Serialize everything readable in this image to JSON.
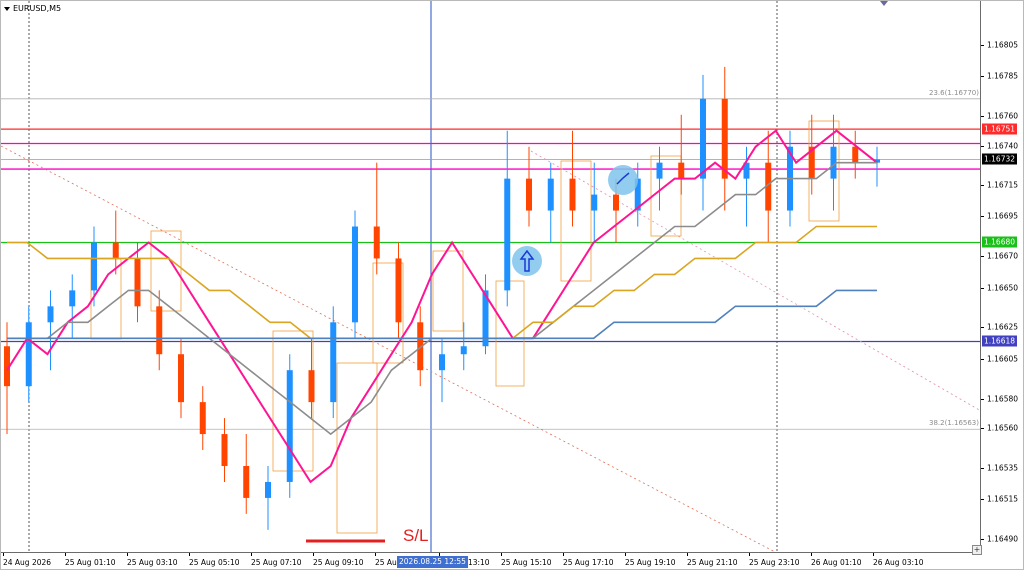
{
  "header": {
    "symbol": "EURUSD,M5"
  },
  "colors": {
    "bull": "#1e90ff",
    "bear": "#ff4500",
    "ma_fast": "#ff1493",
    "ma_mid": "#8c8c8c",
    "ma_slow": "#daa520",
    "ma_long": "#4f81bd",
    "res_red": "#ff2a2a",
    "res_magenta": "#ff00c8",
    "sup_green": "#18c018",
    "sup_blue": "#4040c0",
    "stop_loss": "#e32020",
    "signal_circle": "#7fc4ec",
    "signal_arrow": "#1a3ad8"
  },
  "price_axis": {
    "labels": [
      "1.16805",
      "1.16785",
      "1.16760",
      "1.16740",
      "1.16715",
      "1.16695",
      "1.16670",
      "1.16650",
      "1.16625",
      "1.16605",
      "1.16580",
      "1.16560",
      "1.16535",
      "1.16515",
      "1.16490"
    ],
    "range": [
      1.16488,
      1.16825
    ],
    "tags": [
      {
        "text": "1.16751",
        "price": 1.16751,
        "color": "#ff2a2a"
      },
      {
        "text": "1.16732",
        "price": 1.16732,
        "color": "#000000"
      },
      {
        "text": "1.16680",
        "price": 1.1668,
        "color": "#18c018"
      },
      {
        "text": "1.16618",
        "price": 1.16618,
        "color": "#4040c0"
      }
    ]
  },
  "time_axis": {
    "labels": [
      "24 Aug 2026",
      "25 Aug 01:10",
      "25 Aug 03:10",
      "25 Aug 05:10",
      "25 Aug 07:10",
      "25 Aug 09:10",
      "25 Aug",
      "25 Aug 13:10",
      "25 Aug 15:10",
      "25 Aug 17:10",
      "25 Aug 19:10",
      "25 Aug 21:10",
      "25 Aug 23:10",
      "26 Aug 01:10",
      "26 Aug 03:10"
    ],
    "cursor_date": "2026.08.25 12:55"
  },
  "fibonacci": [
    {
      "text": "23.6(1.16770)",
      "price": 1.1677
    },
    {
      "text": "38.2(1.16563)",
      "price": 1.16563
    }
  ],
  "horizontal_levels": [
    {
      "price": 1.16751,
      "color": "#ff2a2a"
    },
    {
      "price": 1.16742,
      "color": "#ff00c8"
    },
    {
      "price": 1.16726,
      "color": "#ff00c8"
    },
    {
      "price": 1.1668,
      "color": "#18c018"
    },
    {
      "price": 1.16618,
      "color": "#4040c0"
    }
  ],
  "annotations": {
    "stop_loss_label": "S/L"
  },
  "chart_data": {
    "type": "candlestick",
    "title": "EURUSD,M5",
    "ylim": [
      1.16488,
      1.16825
    ],
    "series": [
      {
        "name": "MA fast",
        "color": "#ff1493",
        "values": [
          1.166,
          1.1662,
          1.1661,
          1.1663,
          1.1664,
          1.1666,
          1.1667,
          1.1668,
          1.1667,
          1.1665,
          1.1663,
          1.1661,
          1.1659,
          1.1657,
          1.1655,
          1.1653,
          1.1654,
          1.1657,
          1.1659,
          1.1661,
          1.1663,
          1.1666,
          1.1668,
          1.1666,
          1.1664,
          1.1662,
          1.1662,
          1.1664,
          1.1666,
          1.1668,
          1.1669,
          1.167,
          1.1671,
          1.1672,
          1.1672,
          1.1673,
          1.1672,
          1.1674,
          1.1675,
          1.1673,
          1.1674,
          1.1675,
          1.1674,
          1.1673
        ]
      },
      {
        "name": "MA mid",
        "color": "#8c8c8c",
        "values": [
          1.1662,
          1.1662,
          1.1662,
          1.1663,
          1.1663,
          1.1664,
          1.1665,
          1.1665,
          1.1664,
          1.1663,
          1.1662,
          1.1661,
          1.166,
          1.1659,
          1.1658,
          1.1657,
          1.1656,
          1.1657,
          1.1658,
          1.166,
          1.1661,
          1.1662,
          1.1662,
          1.1662,
          1.1662,
          1.1662,
          1.1662,
          1.1663,
          1.1664,
          1.1665,
          1.1666,
          1.1667,
          1.1668,
          1.1669,
          1.1669,
          1.167,
          1.1671,
          1.1671,
          1.1672,
          1.1672,
          1.1672,
          1.1673,
          1.1673,
          1.1673
        ]
      },
      {
        "name": "MA slow",
        "color": "#daa520",
        "values": [
          1.1668,
          1.1668,
          1.1667,
          1.1667,
          1.1667,
          1.1667,
          1.1667,
          1.1667,
          1.1667,
          1.1666,
          1.1665,
          1.1665,
          1.1664,
          1.1663,
          1.1663,
          1.1662,
          1.1662,
          1.1662,
          1.1662,
          1.1662,
          1.1662,
          1.1662,
          1.1662,
          1.1662,
          1.1662,
          1.1662,
          1.1663,
          1.1663,
          1.1664,
          1.1664,
          1.1665,
          1.1665,
          1.1666,
          1.1666,
          1.1667,
          1.1667,
          1.1667,
          1.1668,
          1.1668,
          1.1668,
          1.1669,
          1.1669,
          1.1669,
          1.1669
        ]
      },
      {
        "name": "MA long",
        "color": "#4f81bd",
        "values": [
          1.1662,
          1.1662,
          1.1662,
          1.1662,
          1.1662,
          1.1662,
          1.1662,
          1.1662,
          1.1662,
          1.1662,
          1.1662,
          1.1662,
          1.1662,
          1.1662,
          1.1662,
          1.1662,
          1.1662,
          1.1662,
          1.1662,
          1.1662,
          1.1662,
          1.1662,
          1.1662,
          1.1662,
          1.1662,
          1.1662,
          1.1662,
          1.1662,
          1.1662,
          1.1662,
          1.1663,
          1.1663,
          1.1663,
          1.1663,
          1.1663,
          1.1663,
          1.1664,
          1.1664,
          1.1664,
          1.1664,
          1.1664,
          1.1665,
          1.1665,
          1.1665
        ]
      }
    ],
    "candles": [
      [
        1.16615,
        1.1663,
        1.1656,
        1.1659
      ],
      [
        1.1659,
        1.1664,
        1.1658,
        1.1663
      ],
      [
        1.1663,
        1.1665,
        1.166,
        1.1664
      ],
      [
        1.1664,
        1.1666,
        1.1662,
        1.1665
      ],
      [
        1.1665,
        1.1669,
        1.1664,
        1.1668
      ],
      [
        1.1668,
        1.167,
        1.1666,
        1.1667
      ],
      [
        1.1667,
        1.1668,
        1.1663,
        1.1664
      ],
      [
        1.1664,
        1.1665,
        1.166,
        1.1661
      ],
      [
        1.1661,
        1.1662,
        1.1657,
        1.1658
      ],
      [
        1.1658,
        1.1659,
        1.1655,
        1.1656
      ],
      [
        1.1656,
        1.1657,
        1.1653,
        1.1654
      ],
      [
        1.1654,
        1.1656,
        1.1651,
        1.1652
      ],
      [
        1.1652,
        1.1654,
        1.165,
        1.1653
      ],
      [
        1.1653,
        1.1661,
        1.1652,
        1.166
      ],
      [
        1.166,
        1.1662,
        1.1657,
        1.1658
      ],
      [
        1.1658,
        1.1664,
        1.1657,
        1.1663
      ],
      [
        1.1663,
        1.167,
        1.1662,
        1.1669
      ],
      [
        1.1669,
        1.1673,
        1.1666,
        1.1667
      ],
      [
        1.1667,
        1.1668,
        1.1662,
        1.1663
      ],
      [
        1.1663,
        1.1664,
        1.1659,
        1.166
      ],
      [
        1.166,
        1.1662,
        1.1658,
        1.1661
      ],
      [
        1.1661,
        1.1663,
        1.166,
        1.16615
      ],
      [
        1.16615,
        1.1666,
        1.1661,
        1.1665
      ],
      [
        1.1665,
        1.1675,
        1.1664,
        1.1672
      ],
      [
        1.1672,
        1.1674,
        1.1669,
        1.167
      ],
      [
        1.167,
        1.1673,
        1.1668,
        1.1672
      ],
      [
        1.1672,
        1.1675,
        1.1669,
        1.167
      ],
      [
        1.167,
        1.1673,
        1.1668,
        1.1671
      ],
      [
        1.1671,
        1.1672,
        1.1668,
        1.167
      ],
      [
        1.167,
        1.1673,
        1.1669,
        1.1672
      ],
      [
        1.1672,
        1.1674,
        1.167,
        1.1673
      ],
      [
        1.1673,
        1.1676,
        1.1671,
        1.1672
      ],
      [
        1.1672,
        1.16785,
        1.167,
        1.1677
      ],
      [
        1.1677,
        1.1679,
        1.167,
        1.1672
      ],
      [
        1.1672,
        1.1674,
        1.1669,
        1.1673
      ],
      [
        1.1673,
        1.1675,
        1.1668,
        1.167
      ],
      [
        1.167,
        1.1675,
        1.1669,
        1.1674
      ],
      [
        1.1674,
        1.1676,
        1.1671,
        1.1672
      ],
      [
        1.1672,
        1.1676,
        1.167,
        1.1674
      ],
      [
        1.1674,
        1.1675,
        1.1672,
        1.1673
      ],
      [
        1.1673,
        1.1674,
        1.16715,
        1.16732
      ]
    ]
  }
}
